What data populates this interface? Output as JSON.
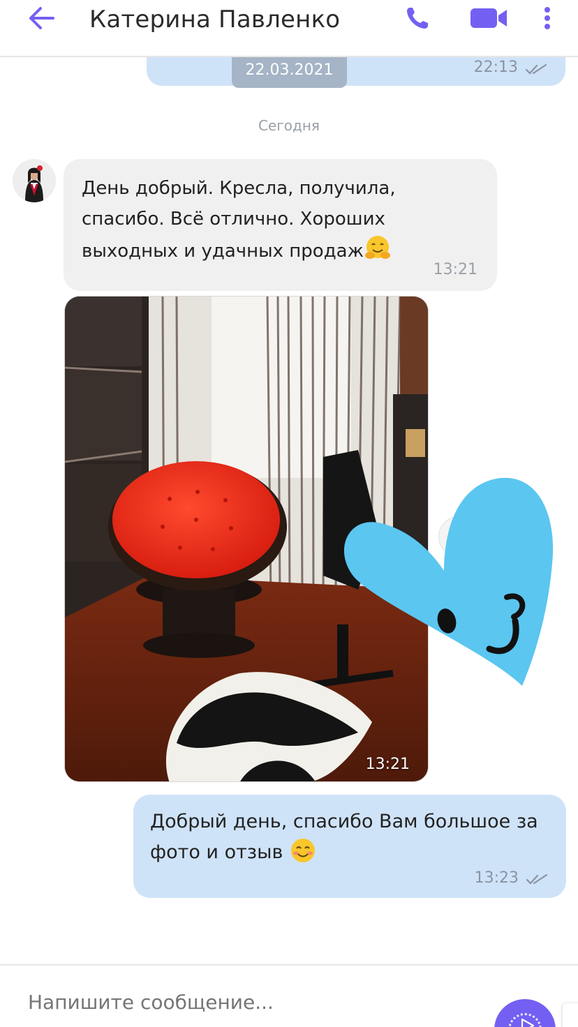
{
  "header": {
    "contact_name": "Катерина Павленко",
    "icons": [
      "back-arrow-icon",
      "phone-icon",
      "video-camera-icon",
      "more-vert-icon"
    ],
    "accent_color": "#7360f2"
  },
  "chat": {
    "previous_message": {
      "time": "22:13",
      "status": "read"
    },
    "date_separator": "22.03.2021",
    "day_label": "Сегодня",
    "incoming": {
      "text": "День добрый. Кресла, получила, спасибо. Всё отлично. Хороших выходных и удачных продаж",
      "emoji": "hugging-face",
      "time": "13:21"
    },
    "photo": {
      "time": "13:21",
      "description_icon": "photo-red-papasan-chair"
    },
    "sticker": "blue-heart-wink-sticker",
    "outgoing": {
      "text": "Добрый день, спасибо Вам большое за фото и отзыв",
      "emoji": "smiling-face",
      "time": "13:23",
      "status": "read"
    }
  },
  "composer": {
    "placeholder": "Напишите сообщение..."
  },
  "colors": {
    "outgoing_bubble": "#cfe3f8",
    "incoming_bubble": "#f0f0f0",
    "date_pill": "#a5b4c6",
    "sticker_heart": "#5bc6f0"
  }
}
